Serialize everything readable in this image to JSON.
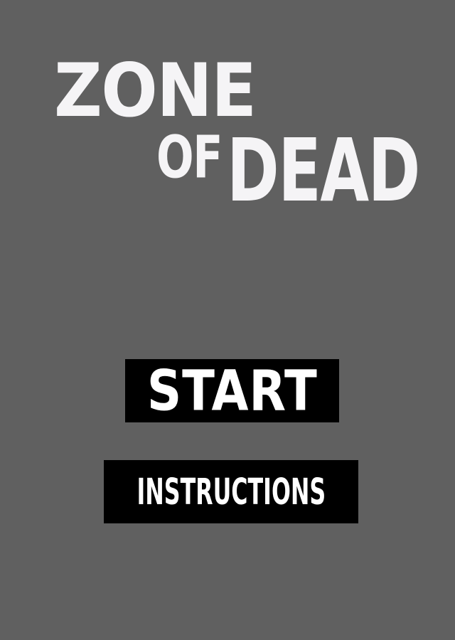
{
  "game": {
    "title_line1": "ZONE",
    "title_line2a": "OF",
    "title_line2b": "DEAD"
  },
  "menu": {
    "start_label": "START",
    "instructions_label": "INSTRUCTIONS"
  },
  "colors": {
    "background": "#606060",
    "title_text": "#f5f4f6",
    "button_background": "#000000",
    "button_text": "#ffffff"
  }
}
